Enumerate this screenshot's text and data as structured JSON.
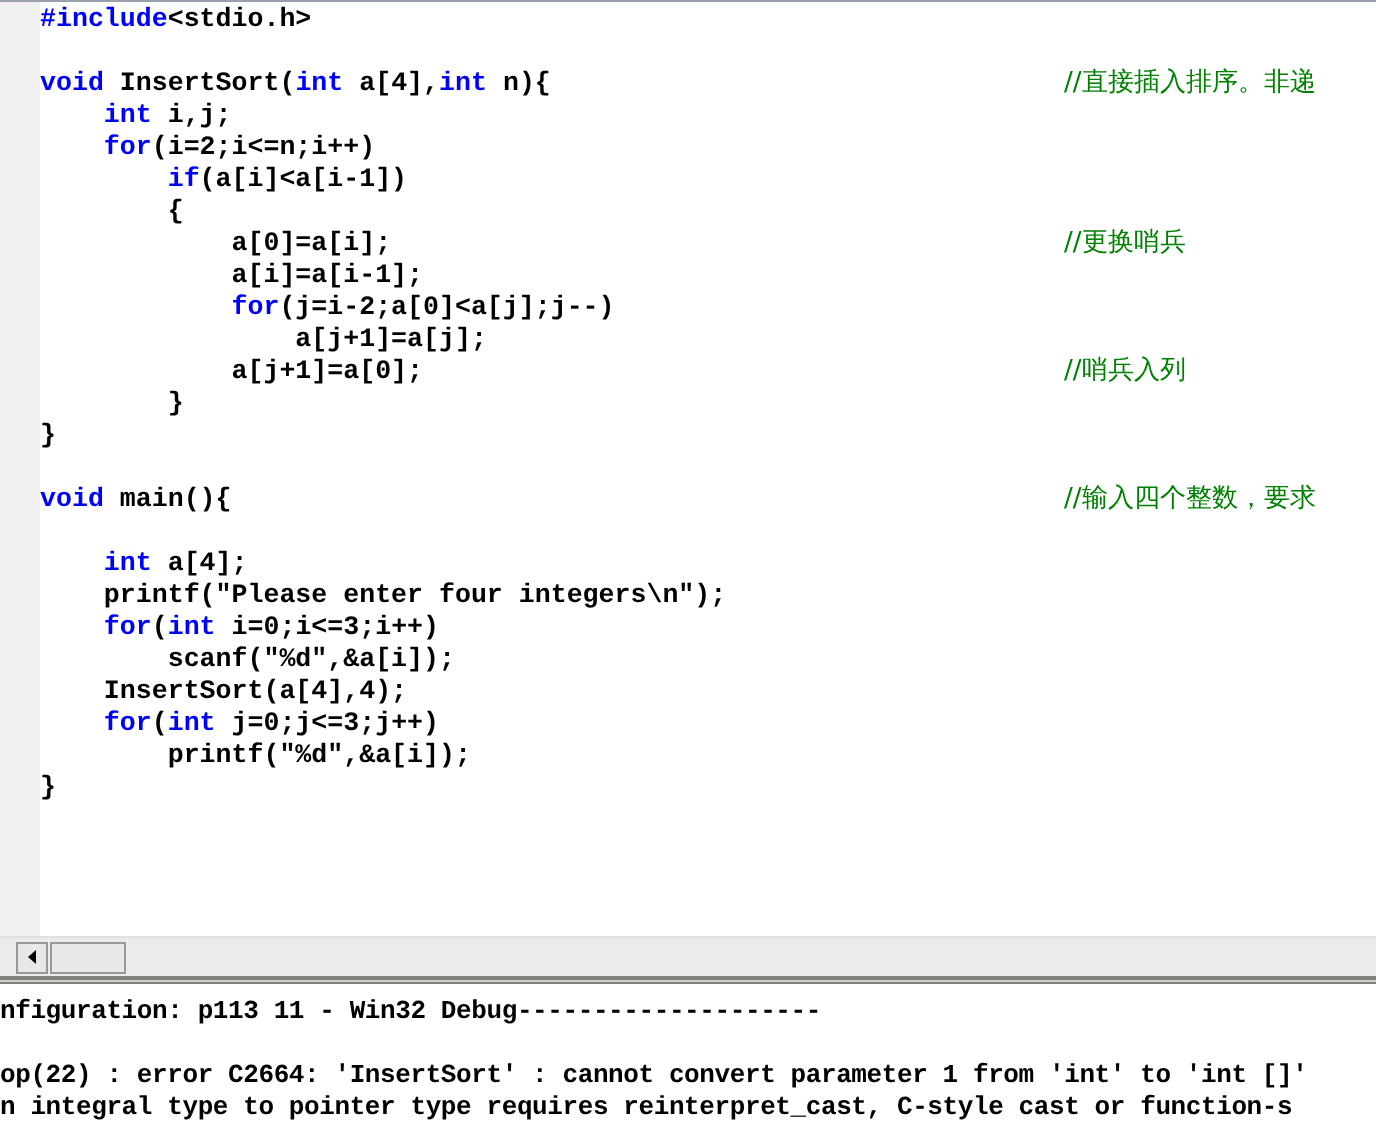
{
  "editor": {
    "blocks": [
      {
        "lines": [
          {
            "segments": [
              {
                "kind": "keyword",
                "text": "#include"
              },
              {
                "kind": "plain",
                "text": "<stdio.h>"
              }
            ]
          }
        ]
      },
      {
        "lines": [
          {
            "segments": [
              {
                "kind": "keyword",
                "text": "void"
              },
              {
                "kind": "plain",
                "text": " InsertSort("
              },
              {
                "kind": "keyword",
                "text": "int"
              },
              {
                "kind": "plain",
                "text": " a[4],"
              },
              {
                "kind": "keyword",
                "text": "int"
              },
              {
                "kind": "plain",
                "text": " n){"
              }
            ],
            "comment": "//直接插入排序。非递"
          },
          {
            "segments": [
              {
                "kind": "keyword",
                "text": "    int"
              },
              {
                "kind": "plain",
                "text": " i,j;"
              }
            ]
          },
          {
            "segments": [
              {
                "kind": "keyword",
                "text": "    for"
              },
              {
                "kind": "plain",
                "text": "(i=2;i<=n;i++)"
              }
            ]
          },
          {
            "segments": [
              {
                "kind": "keyword",
                "text": "        if"
              },
              {
                "kind": "plain",
                "text": "(a[i]<a[i-1])"
              }
            ]
          },
          {
            "segments": [
              {
                "kind": "plain",
                "text": "        {"
              }
            ]
          },
          {
            "segments": [
              {
                "kind": "plain",
                "text": "            a[0]=a[i];"
              }
            ],
            "comment": "//更换哨兵"
          },
          {
            "segments": [
              {
                "kind": "plain",
                "text": "            a[i]=a[i-1];"
              }
            ]
          },
          {
            "segments": [
              {
                "kind": "keyword",
                "text": "            for"
              },
              {
                "kind": "plain",
                "text": "(j=i-2;a[0]<a[j];j--)"
              }
            ]
          },
          {
            "segments": [
              {
                "kind": "plain",
                "text": "                a[j+1]=a[j];"
              }
            ]
          },
          {
            "segments": [
              {
                "kind": "plain",
                "text": "            a[j+1]=a[0];"
              }
            ],
            "comment": "//哨兵入列"
          },
          {
            "segments": [
              {
                "kind": "plain",
                "text": "        }"
              }
            ]
          },
          {
            "segments": [
              {
                "kind": "plain",
                "text": "}"
              }
            ]
          }
        ]
      },
      {
        "lines": [
          {
            "segments": [
              {
                "kind": "keyword",
                "text": "void"
              },
              {
                "kind": "plain",
                "text": " main(){"
              }
            ],
            "comment": "//输入四个整数，要求"
          }
        ]
      },
      {
        "lines": [
          {
            "segments": [
              {
                "kind": "keyword",
                "text": "    int"
              },
              {
                "kind": "plain",
                "text": " a[4];"
              }
            ]
          },
          {
            "segments": [
              {
                "kind": "plain",
                "text": "    printf(\"Please enter four integers\\n\");"
              }
            ]
          },
          {
            "segments": [
              {
                "kind": "keyword",
                "text": "    for"
              },
              {
                "kind": "plain",
                "text": "("
              },
              {
                "kind": "keyword",
                "text": "int"
              },
              {
                "kind": "plain",
                "text": " i=0;i<=3;i++)"
              }
            ]
          },
          {
            "segments": [
              {
                "kind": "plain",
                "text": "        scanf(\"%d\",&a[i]);"
              }
            ]
          },
          {
            "segments": [
              {
                "kind": "plain",
                "text": "    InsertSort(a[4],4);"
              }
            ]
          },
          {
            "segments": [
              {
                "kind": "keyword",
                "text": "    for"
              },
              {
                "kind": "plain",
                "text": "("
              },
              {
                "kind": "keyword",
                "text": "int"
              },
              {
                "kind": "plain",
                "text": " j=0;j<=3;j++)"
              }
            ]
          },
          {
            "segments": [
              {
                "kind": "plain",
                "text": "        printf(\"%d\",&a[i]);"
              }
            ]
          },
          {
            "segments": [
              {
                "kind": "plain",
                "text": "}"
              }
            ]
          }
        ]
      }
    ]
  },
  "output": {
    "header": "nfiguration: p113 11 - Win32 Debug--------------------",
    "messages": [
      "op(22) : error C2664: 'InsertSort' : cannot convert parameter 1 from 'int' to 'int []'",
      "n integral type to pointer type requires reinterpret_cast, C-style cast or function-s"
    ]
  }
}
